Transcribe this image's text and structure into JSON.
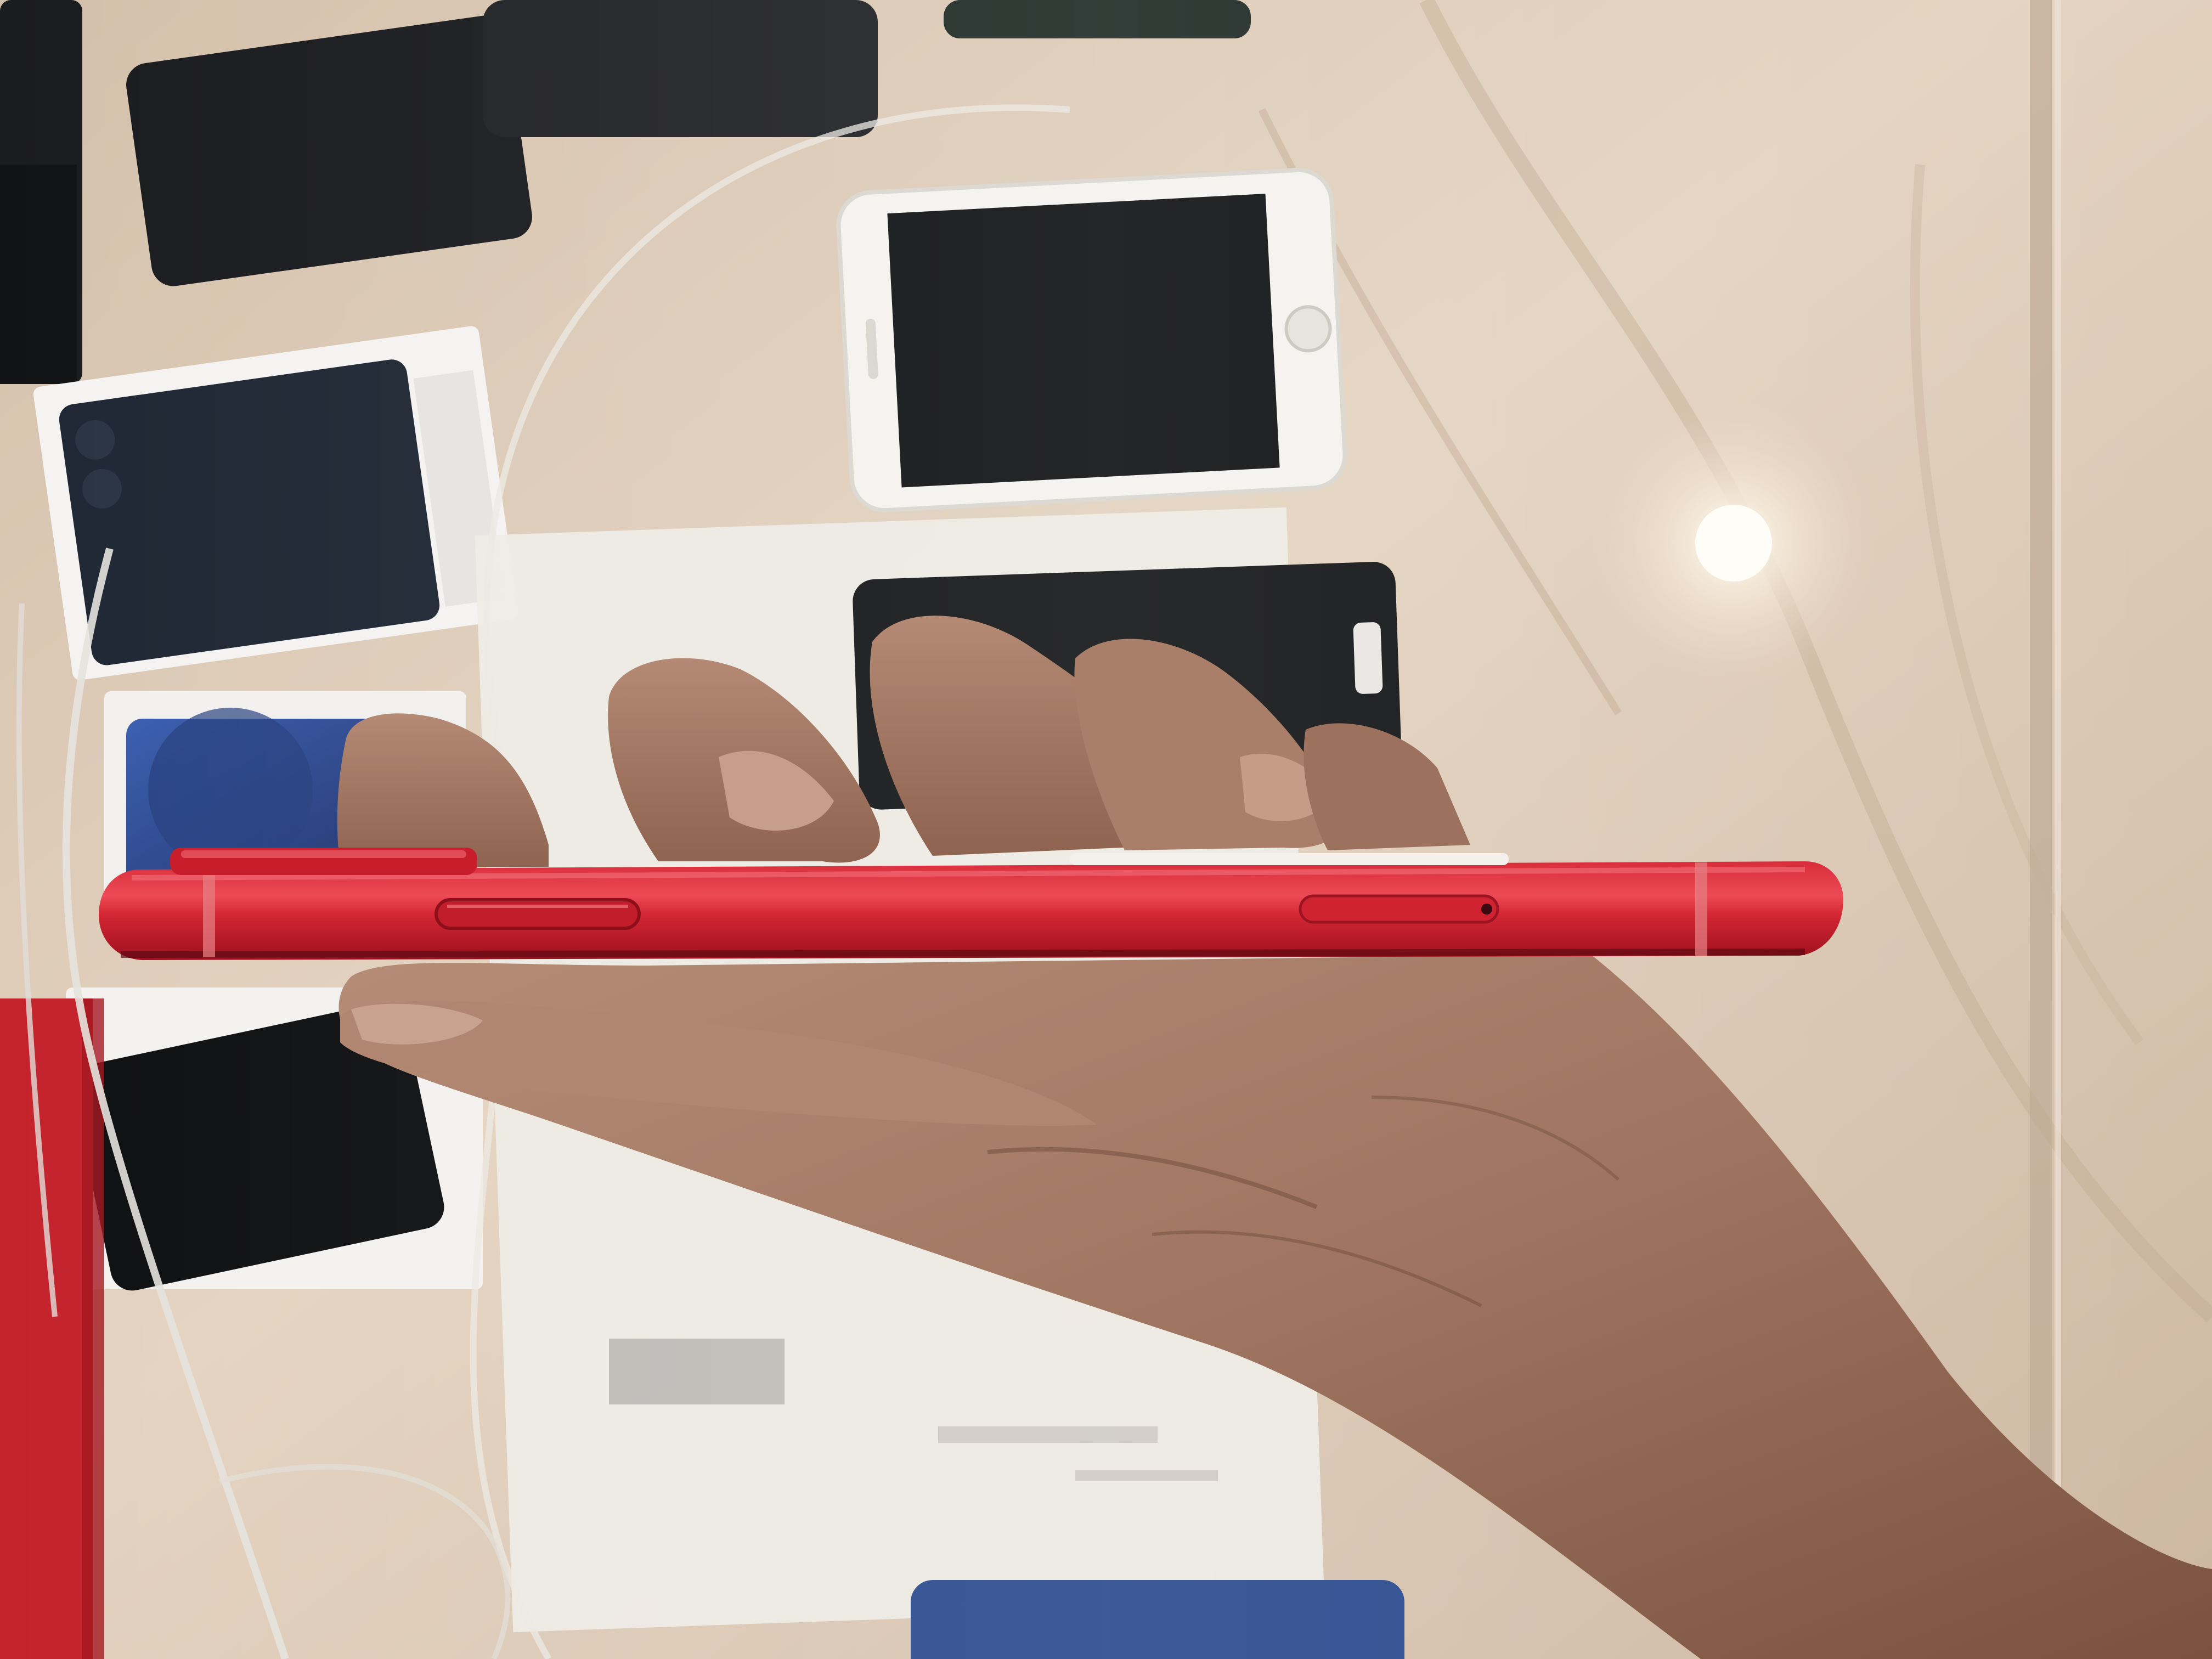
{
  "photo": {
    "subject": "red-phone-side-profile-in-hand",
    "colors": {
      "marble_base": "#d8c5b2",
      "marble_light": "#ebdcc9",
      "marble_dark": "#b9a48e",
      "glass_reflection": "#f4ece2",
      "phone_red": "#d42634",
      "phone_red_dark": "#a4121f",
      "phone_red_highlight": "#ec5a62",
      "skin": "#a9806a",
      "skin_shadow": "#7e5645",
      "skin_light": "#c69a82",
      "box_white": "#f2f1ef",
      "screen_black": "#111214",
      "red_box": "#c4232c",
      "blue_phone": "#2f4c93",
      "cable_white": "#e7e4df"
    }
  }
}
